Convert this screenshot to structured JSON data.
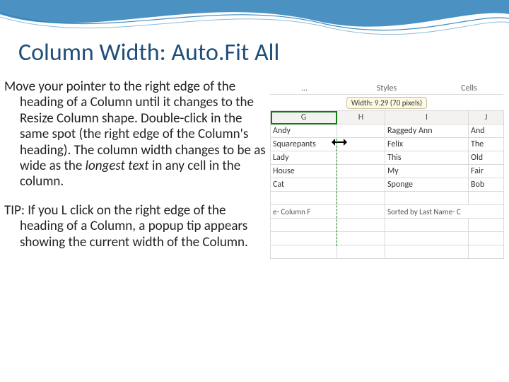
{
  "title": "Column Width: Auto.Fit All",
  "body": {
    "p1_pre": "Move your pointer to the right edge of the heading of a Column until it changes to the Resize Column shape.   Double-click in the same spot (the right edge of the Column's heading).  The column width changes to be as wide as the ",
    "p1_em": "longest text",
    "p1_post": " in any cell in the column.",
    "p2": "TIP: If you L click on the right edge of the heading of a Column, a popup tip appears showing the current width of the Column."
  },
  "shot": {
    "ribbon": {
      "seg1": "…",
      "seg2": "Styles",
      "seg3": "Cells"
    },
    "width_tip": "Width: 9.29 (70 pixels)",
    "headers": {
      "g": "G",
      "h": "H",
      "i": "I",
      "j": "J"
    },
    "rows": [
      {
        "g": "Andy",
        "h": "",
        "i": "Raggedy Ann",
        "j": "And"
      },
      {
        "g": "Squarepants",
        "h": "",
        "i": "Felix",
        "j": "The"
      },
      {
        "g": "Lady",
        "h": "",
        "i": "This",
        "j": "Old"
      },
      {
        "g": "House",
        "h": "",
        "i": "My",
        "j": "Fair"
      },
      {
        "g": "Cat",
        "h": "",
        "i": "Sponge",
        "j": "Bob"
      }
    ],
    "footer": {
      "left": "e- Column F",
      "right": "Sorted by Last Name- C"
    }
  }
}
